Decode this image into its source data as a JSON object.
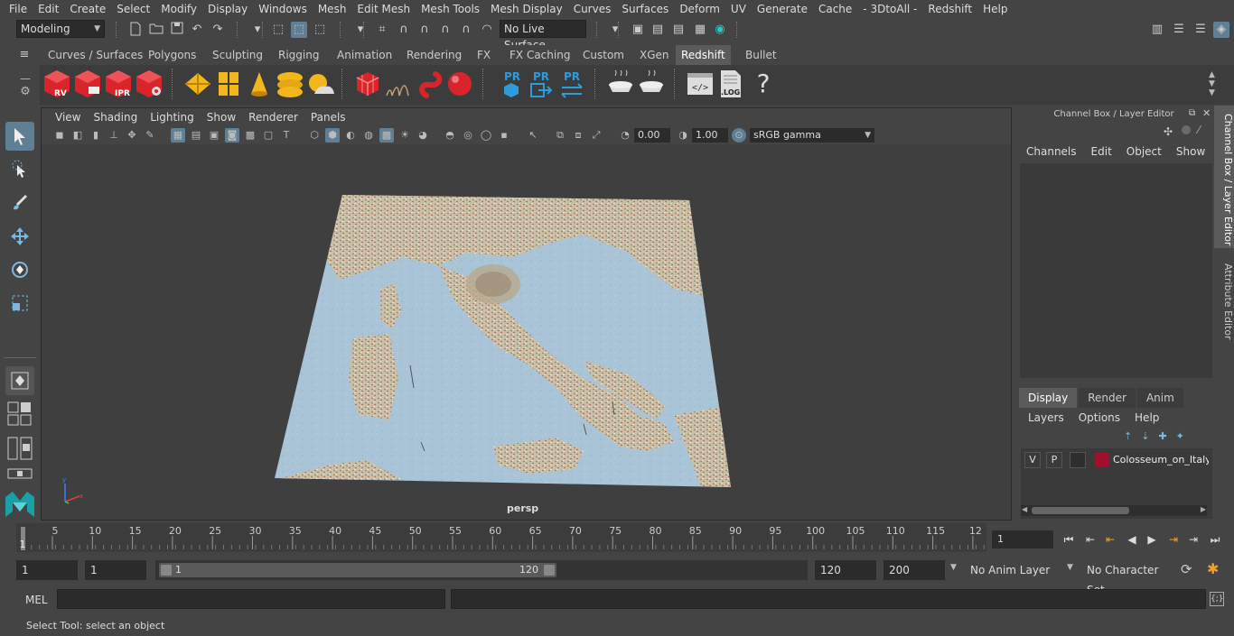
{
  "menubar": {
    "items": [
      "File",
      "Edit",
      "Create",
      "Select",
      "Modify",
      "Display",
      "Windows",
      "Mesh",
      "Edit Mesh",
      "Mesh Tools",
      "Mesh Display",
      "Curves",
      "Surfaces",
      "Deform",
      "UV",
      "Generate",
      "Cache",
      "- 3DtoAll -",
      "Redshift",
      "Help"
    ]
  },
  "statusline": {
    "mode": "Modeling",
    "live_surface": "No Live Surface"
  },
  "shelf": {
    "tabs": [
      "Curves / Surfaces",
      "Polygons",
      "Sculpting",
      "Rigging",
      "Animation",
      "Rendering",
      "FX",
      "FX Caching",
      "Custom",
      "XGen",
      "Redshift",
      "Bullet"
    ],
    "active_tab": "Redshift",
    "icon_labels": {
      "rv": "RV",
      "ipr": "IPR",
      "pr": "PR",
      "log": ".LOG",
      "help": "?"
    }
  },
  "viewport": {
    "menu": [
      "View",
      "Shading",
      "Lighting",
      "Show",
      "Renderer",
      "Panels"
    ],
    "exposure": "0.00",
    "gamma": "1.00",
    "color_space": "sRGB gamma",
    "camera_label": "persp"
  },
  "channel_box": {
    "title": "Channel Box / Layer Editor",
    "menu": [
      "Channels",
      "Edit",
      "Object",
      "Show"
    ]
  },
  "layer_editor": {
    "tabs": [
      "Display",
      "Render",
      "Anim"
    ],
    "active_tab": "Display",
    "menu": [
      "Layers",
      "Options",
      "Help"
    ],
    "layer": {
      "v": "V",
      "p": "P",
      "name": "Colosseum_on_Italy_M",
      "color": "#a0102a"
    }
  },
  "side_tabs": [
    "Channel Box / Layer Editor",
    "Attribute Editor"
  ],
  "timeline": {
    "ticks": [
      "5",
      "10",
      "15",
      "20",
      "25",
      "30",
      "35",
      "40",
      "45",
      "50",
      "55",
      "60",
      "65",
      "70",
      "75",
      "80",
      "85",
      "90",
      "95",
      "100",
      "105",
      "110",
      "115",
      "12"
    ],
    "start_marker": "1",
    "current_frame": "1"
  },
  "range": {
    "start_field": "1",
    "start_inner": "1",
    "slider_start": "1",
    "slider_end": "120",
    "end_inner": "120",
    "end_field": "200",
    "anim_layer": "No Anim Layer",
    "character_set": "No Character Set"
  },
  "cmdline": {
    "label": "MEL"
  },
  "helpline": {
    "text": "Select Tool: select an object"
  }
}
